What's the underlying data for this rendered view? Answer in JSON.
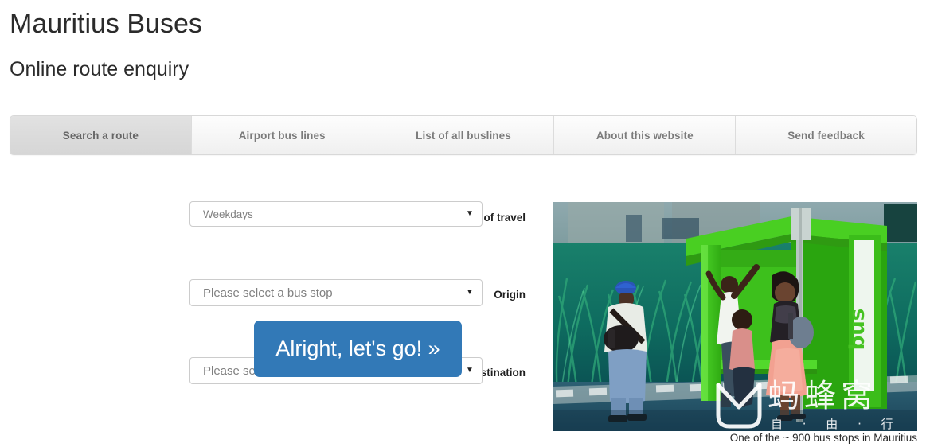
{
  "header": {
    "title": "Mauritius Buses",
    "subtitle": "Online route enquiry"
  },
  "tabs": [
    {
      "label": "Search a route",
      "active": true
    },
    {
      "label": "Airport bus lines",
      "active": false
    },
    {
      "label": "List of all buslines",
      "active": false
    },
    {
      "label": "About this website",
      "active": false
    },
    {
      "label": "Send feedback",
      "active": false
    }
  ],
  "form": {
    "day_of_travel": {
      "label": "Day of travel",
      "value": "Weekdays",
      "caret": "▼"
    },
    "origin": {
      "label": "Origin",
      "value": "Please select a bus stop",
      "caret": "▼"
    },
    "destination": {
      "label": "Destination",
      "value": "Please select a bus stop",
      "caret": "▼"
    },
    "submit_label": "Alright, let's go! »"
  },
  "photo": {
    "caption": "One of the ~ 900 bus stops in Mauritius",
    "alt": "Green bus shelter beside tall sugar cane grass with people waiting",
    "shelter_text": "bus",
    "watermark_text": "蚂蜂窝",
    "watermark_sub": "自 · 由 · 行"
  },
  "colors": {
    "accent_blue": "#3279b7",
    "shelter_green": "#3fbf1f",
    "tab_active_bg": "#dcdcdc",
    "tab_inactive_bg": "#f6f6f6",
    "text_dark": "#2b2b2b",
    "text_muted": "#7b7b7b",
    "border": "#cccccc"
  }
}
